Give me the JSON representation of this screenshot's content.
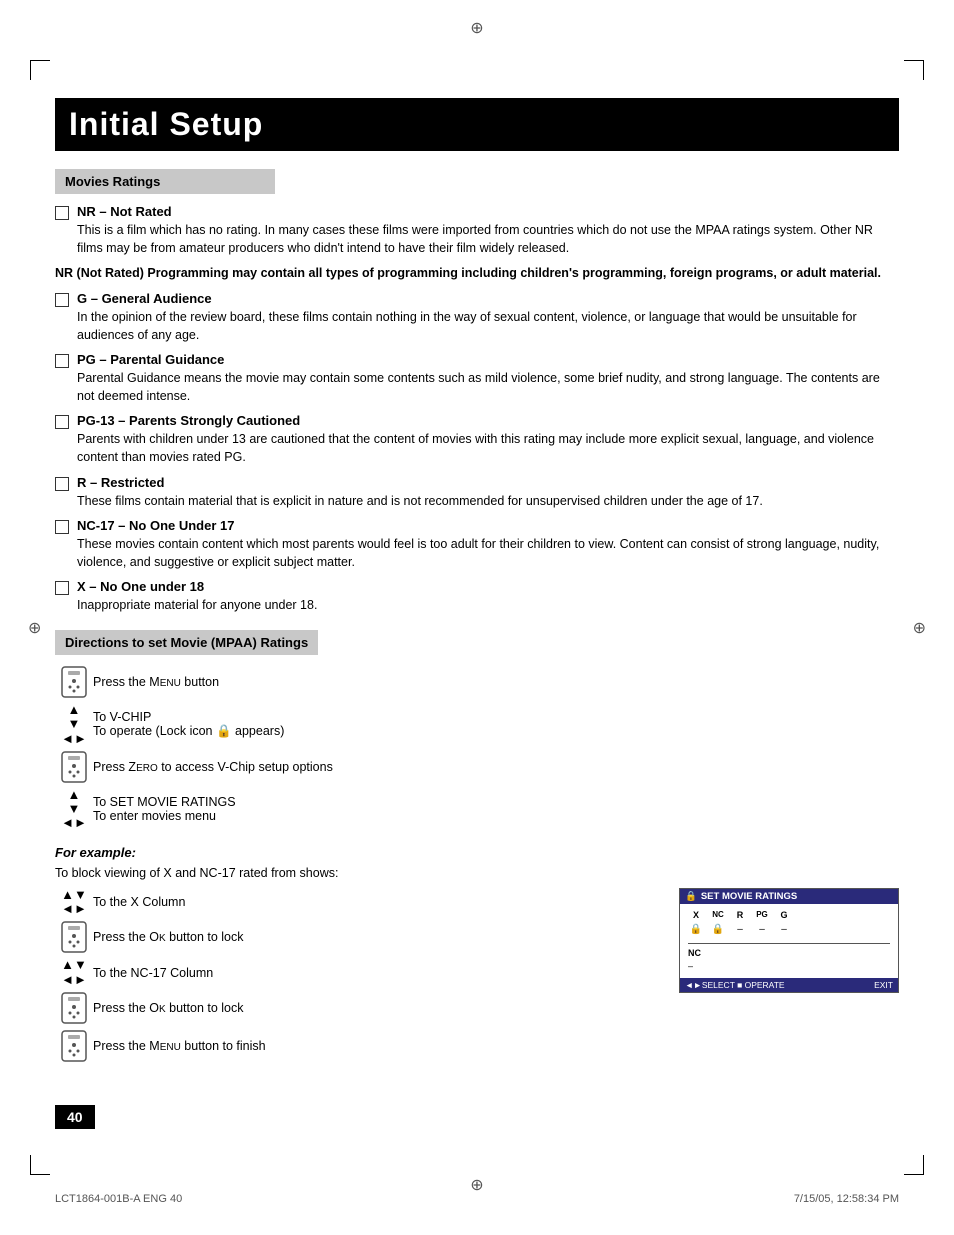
{
  "page": {
    "title": "Initial Setup",
    "page_number": "40",
    "footer_left": "LCT1864-001B-A ENG  40",
    "footer_right": "7/15/05, 12:58:34 PM"
  },
  "sections": {
    "movies_ratings": {
      "header": "Movies Ratings",
      "ratings": [
        {
          "id": "NR",
          "title": "NR – Not Rated",
          "description": "This is a film which has no rating. In many cases these films were imported from countries which do not use the MPAA ratings system. Other NR films may be from amateur producers who didn't intend to have their film widely released."
        },
        {
          "id": "NR_NOTICE",
          "title": "",
          "description": "NR (Not Rated) Programming may contain all types of programming including children's programming, foreign programs, or adult material."
        },
        {
          "id": "G",
          "title": "G – General Audience",
          "description": "In the opinion of the review board, these films contain nothing in the way of sexual content, violence, or language that would be unsuitable for audiences of any age."
        },
        {
          "id": "PG",
          "title": "PG – Parental Guidance",
          "description": "Parental Guidance means the movie may contain some contents such as mild violence, some brief nudity, and strong language. The contents are not deemed intense."
        },
        {
          "id": "PG13",
          "title": "PG-13 – Parents Strongly Cautioned",
          "description": "Parents with children under 13 are cautioned that the content of movies with this rating may include more explicit sexual, language, and violence content than movies rated PG."
        },
        {
          "id": "R",
          "title": "R – Restricted",
          "description": "These films contain material that is explicit in nature and is not recommended for unsupervised children under the age of 17."
        },
        {
          "id": "NC17",
          "title": "NC-17 – No One Under 17",
          "description": "These movies contain content which most parents would feel is too adult for their children to view. Content can consist of strong language, nudity, violence, and suggestive or explicit subject matter."
        },
        {
          "id": "X",
          "title": "X – No One under 18",
          "description": "Inappropriate material for anyone under 18."
        }
      ]
    },
    "directions": {
      "header": "Directions to set Movie (MPAA) Ratings",
      "steps": [
        {
          "icon_type": "remote",
          "text": "Press the MENU button"
        },
        {
          "icon_type": "arrows_ud_lr",
          "text_line1": "To V-CHIP",
          "text_line2": "To operate (Lock icon 🔒 appears)"
        },
        {
          "icon_type": "remote",
          "text": "Press ZERO to access V-Chip setup options"
        },
        {
          "icon_type": "arrows_ud_lr",
          "text_line1": "To SET MOVIE RATINGS",
          "text_line2": "To enter movies menu"
        }
      ],
      "for_example": {
        "title": "For example:",
        "description": "To block viewing of X and NC-17 rated from shows:",
        "steps": [
          {
            "icon_type": "arrows_ud_lr",
            "text": "To the X Column"
          },
          {
            "icon_type": "remote",
            "text": "Press the OK button to lock"
          },
          {
            "icon_type": "arrows_ud_lr",
            "text": "To the NC-17 Column"
          },
          {
            "icon_type": "remote",
            "text": "Press the OK button to lock"
          },
          {
            "icon_type": "remote",
            "text": "Press the MENU button to finish"
          }
        ]
      }
    }
  },
  "tv_screen": {
    "title": "SET MOVIE RATINGS",
    "ratings_row": [
      "X",
      "NC",
      "R",
      "PG",
      "G"
    ],
    "lock_row1": [
      "🔒",
      "🔒",
      "–",
      "–",
      "–"
    ],
    "nc_label": "NC",
    "dash": "–",
    "bottom_bar": {
      "left": "◄►SELECT  ■ OPERATE",
      "right": "EXIT"
    }
  }
}
